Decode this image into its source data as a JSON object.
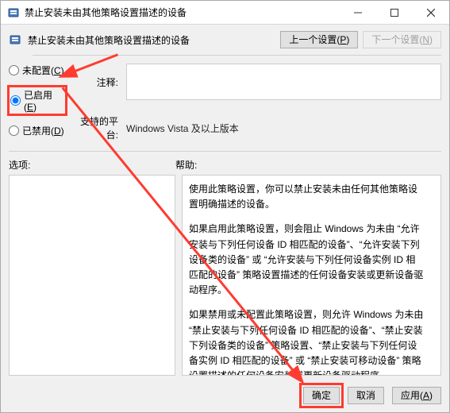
{
  "window": {
    "title": "禁止安装未由其他策略设置描述的设备"
  },
  "subheader": {
    "title": "禁止安装未由其他策略设置描述的设备"
  },
  "nav": {
    "prev_label": "上一个设置(",
    "prev_accel": "P",
    "prev_tail": ")",
    "next_label": "下一个设置(",
    "next_accel": "N",
    "next_tail": ")"
  },
  "radios": {
    "not_configured": {
      "label": "未配置(",
      "accel": "C",
      "tail": ")"
    },
    "enabled": {
      "label": "已启用(",
      "accel": "E",
      "tail": ")"
    },
    "disabled": {
      "label": "已禁用(",
      "accel": "D",
      "tail": ")"
    },
    "selected": "enabled"
  },
  "meta": {
    "comment_label": "注释:",
    "platform_label": "支持的平台:",
    "platform_value": "Windows Vista 及以上版本"
  },
  "lower": {
    "options_label": "选项:",
    "help_label": "帮助:"
  },
  "help": {
    "p1": "使用此策略设置，你可以禁止安装未由任何其他策略设置明确描述的设备。",
    "p2": "如果启用此策略设置，则会阻止 Windows 为未由 “允许安装与下列任何设备 ID 相匹配的设备”、“允许安装下列设备类的设备” 或 “允许安装与下列任何设备实例 ID 相匹配的设备” 策略设置描述的任何设备安装或更新设备驱动程序。",
    "p3": "如果禁用或未配置此策略设置，则允许 Windows 为未由 “禁止安装与下列任何设备 ID 相匹配的设备”、“禁止安装下列设备类的设备” 策略设置、“禁止安装与下列任何设备实例 ID 相匹配的设备” 或 “禁止安装可移动设备” 策略设置描述的任何设备安装或更新设备驱动程序。"
  },
  "footer": {
    "ok": "确定",
    "cancel": "取消",
    "apply_label": "应用(",
    "apply_accel": "A",
    "apply_tail": ")"
  },
  "colors": {
    "annotation": "#ff3b30"
  }
}
